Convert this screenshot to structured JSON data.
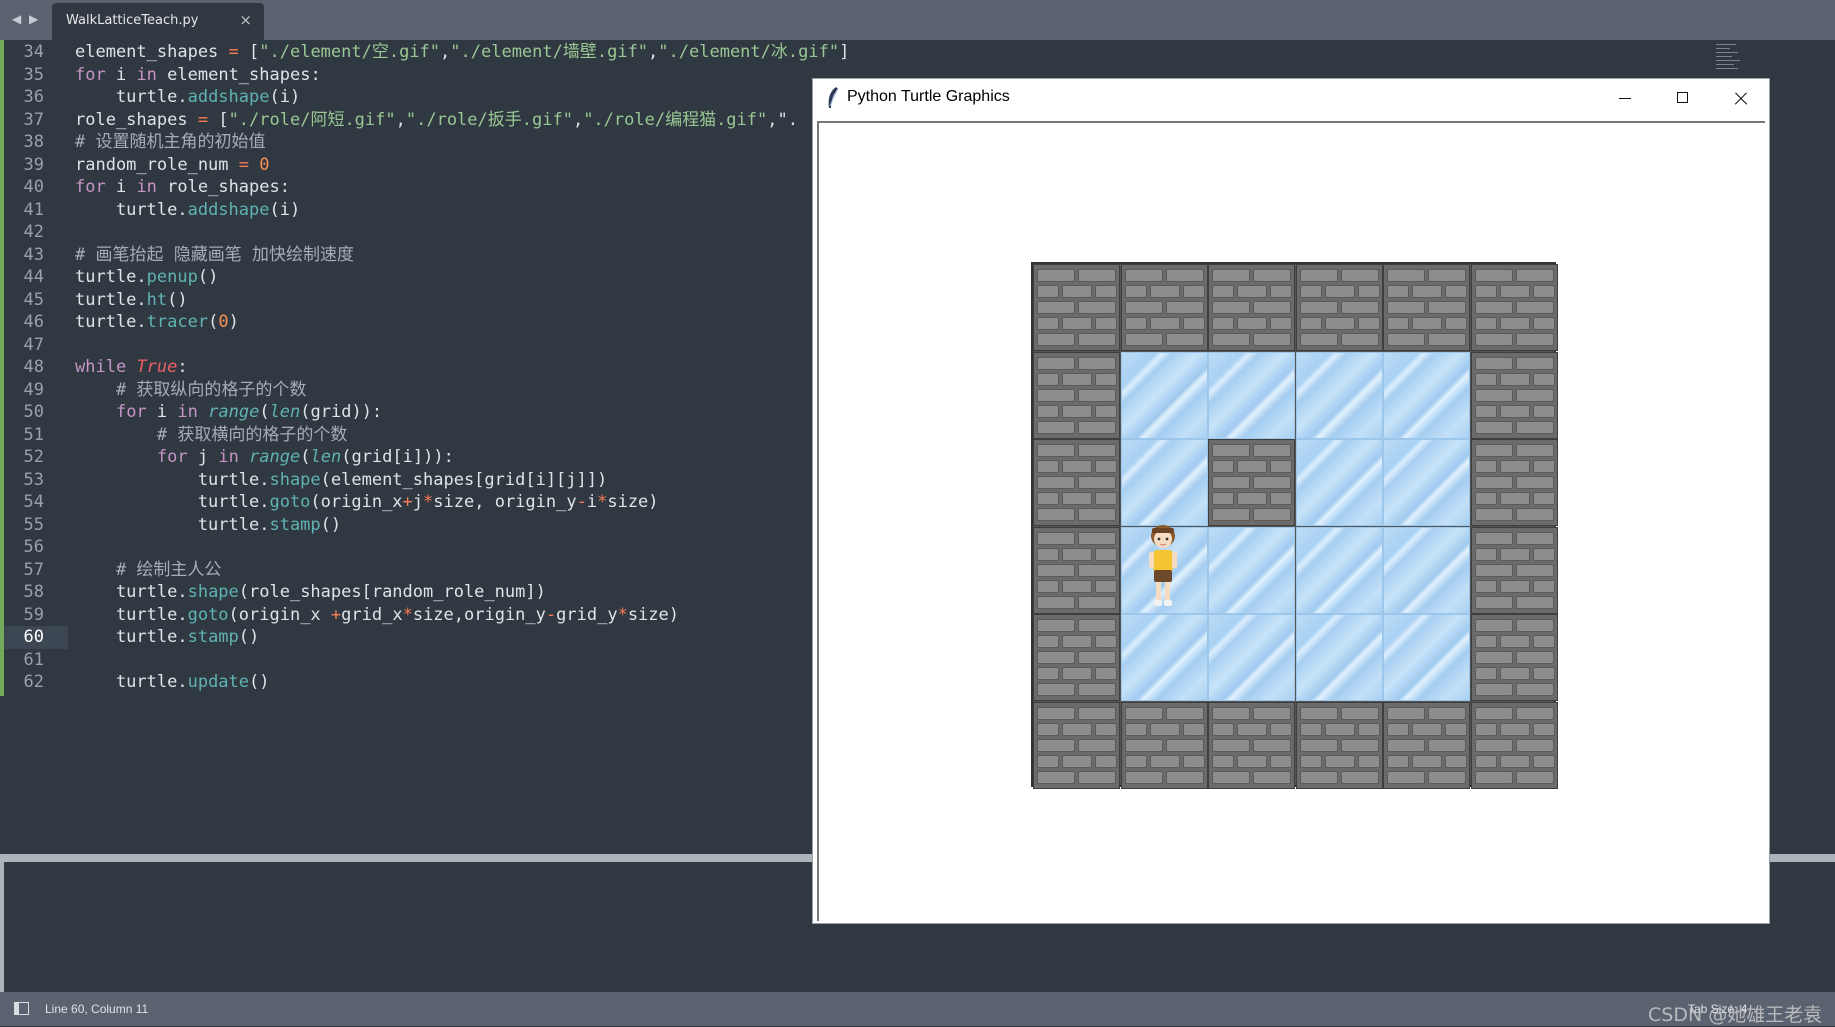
{
  "tabs": [
    {
      "label": "WalkLatticeTeach.py",
      "close": "×"
    }
  ],
  "nav": {
    "back": "◀",
    "forward": "▶"
  },
  "editor": {
    "current_line": "60",
    "lines": [
      {
        "n": "34",
        "segs": [
          [
            "",
            "element_shapes "
          ],
          [
            "o",
            "="
          ],
          [
            "",
            " ["
          ],
          [
            "s",
            "\"./element/空.gif\""
          ],
          [
            "",
            ","
          ],
          [
            "s",
            "\"./element/墙壁.gif\""
          ],
          [
            "",
            ","
          ],
          [
            "s",
            "\"./element/冰.gif\""
          ],
          [
            "",
            "]"
          ]
        ]
      },
      {
        "n": "35",
        "segs": [
          [
            "k",
            "for"
          ],
          [
            "",
            " i "
          ],
          [
            "k",
            "in"
          ],
          [
            "",
            " element_shapes:"
          ]
        ]
      },
      {
        "n": "36",
        "segs": [
          [
            "",
            "    turtle."
          ],
          [
            "f",
            "addshape"
          ],
          [
            "",
            "(i)"
          ]
        ]
      },
      {
        "n": "37",
        "segs": [
          [
            "",
            "role_shapes "
          ],
          [
            "o",
            "="
          ],
          [
            "",
            " ["
          ],
          [
            "s",
            "\"./role/阿短.gif\""
          ],
          [
            "",
            ","
          ],
          [
            "s",
            "\"./role/扳手.gif\""
          ],
          [
            "",
            ","
          ],
          [
            "s",
            "\"./role/编程猫.gif\""
          ],
          [
            "",
            ",\"."
          ]
        ]
      },
      {
        "n": "38",
        "segs": [
          [
            "c",
            "# 设置随机主角的初始值"
          ]
        ]
      },
      {
        "n": "39",
        "segs": [
          [
            "",
            "random_role_num "
          ],
          [
            "o",
            "="
          ],
          [
            "",
            " "
          ],
          [
            "n",
            "0"
          ]
        ]
      },
      {
        "n": "40",
        "segs": [
          [
            "k",
            "for"
          ],
          [
            "",
            " i "
          ],
          [
            "k",
            "in"
          ],
          [
            "",
            " role_shapes:"
          ]
        ]
      },
      {
        "n": "41",
        "segs": [
          [
            "",
            "    turtle."
          ],
          [
            "f",
            "addshape"
          ],
          [
            "",
            "(i)"
          ]
        ]
      },
      {
        "n": "42",
        "segs": []
      },
      {
        "n": "43",
        "segs": [
          [
            "c",
            "# 画笔抬起 隐藏画笔 加快绘制速度"
          ]
        ]
      },
      {
        "n": "44",
        "segs": [
          [
            "",
            "turtle."
          ],
          [
            "f",
            "penup"
          ],
          [
            "",
            "()"
          ]
        ]
      },
      {
        "n": "45",
        "segs": [
          [
            "",
            "turtle."
          ],
          [
            "f",
            "ht"
          ],
          [
            "",
            "()"
          ]
        ]
      },
      {
        "n": "46",
        "segs": [
          [
            "",
            "turtle."
          ],
          [
            "f",
            "tracer"
          ],
          [
            "",
            "("
          ],
          [
            "n",
            "0"
          ],
          [
            "",
            ")"
          ]
        ]
      },
      {
        "n": "47",
        "segs": []
      },
      {
        "n": "48",
        "segs": [
          [
            "k",
            "while"
          ],
          [
            "",
            " "
          ],
          [
            "b",
            "True"
          ],
          [
            "",
            ":"
          ]
        ]
      },
      {
        "n": "49",
        "segs": [
          [
            "",
            "    "
          ],
          [
            "c",
            "# 获取纵向的格子的个数"
          ]
        ]
      },
      {
        "n": "50",
        "segs": [
          [
            "",
            "    "
          ],
          [
            "k",
            "for"
          ],
          [
            "",
            " i "
          ],
          [
            "k",
            "in"
          ],
          [
            "",
            " "
          ],
          [
            "fi",
            "range"
          ],
          [
            "",
            "("
          ],
          [
            "fi",
            "len"
          ],
          [
            "",
            "(grid)):"
          ]
        ]
      },
      {
        "n": "51",
        "segs": [
          [
            "",
            "        "
          ],
          [
            "c",
            "# 获取横向的格子的个数"
          ]
        ]
      },
      {
        "n": "52",
        "segs": [
          [
            "",
            "        "
          ],
          [
            "k",
            "for"
          ],
          [
            "",
            " j "
          ],
          [
            "k",
            "in"
          ],
          [
            "",
            " "
          ],
          [
            "fi",
            "range"
          ],
          [
            "",
            "("
          ],
          [
            "fi",
            "len"
          ],
          [
            "",
            "(grid[i])):"
          ]
        ]
      },
      {
        "n": "53",
        "segs": [
          [
            "",
            "            turtle."
          ],
          [
            "f",
            "shape"
          ],
          [
            "",
            "(element_shapes[grid[i][j]])"
          ]
        ]
      },
      {
        "n": "54",
        "segs": [
          [
            "",
            "            turtle."
          ],
          [
            "f",
            "goto"
          ],
          [
            "",
            "(origin_x"
          ],
          [
            "o",
            "+"
          ],
          [
            "",
            "j"
          ],
          [
            "o",
            "*"
          ],
          [
            "",
            "size, origin_y"
          ],
          [
            "o",
            "-"
          ],
          [
            "",
            "i"
          ],
          [
            "o",
            "*"
          ],
          [
            "",
            "size)"
          ]
        ]
      },
      {
        "n": "55",
        "segs": [
          [
            "",
            "            turtle."
          ],
          [
            "f",
            "stamp"
          ],
          [
            "",
            "()"
          ]
        ]
      },
      {
        "n": "56",
        "segs": []
      },
      {
        "n": "57",
        "segs": [
          [
            "",
            "    "
          ],
          [
            "c",
            "# 绘制主人公"
          ]
        ]
      },
      {
        "n": "58",
        "segs": [
          [
            "",
            "    turtle."
          ],
          [
            "f",
            "shape"
          ],
          [
            "",
            "(role_shapes[random_role_num])"
          ]
        ]
      },
      {
        "n": "59",
        "segs": [
          [
            "",
            "    turtle."
          ],
          [
            "f",
            "goto"
          ],
          [
            "",
            "(origin_x "
          ],
          [
            "o",
            "+"
          ],
          [
            "",
            "grid_x"
          ],
          [
            "o",
            "*"
          ],
          [
            "",
            "size,origin_y"
          ],
          [
            "o",
            "-"
          ],
          [
            "",
            "grid_y"
          ],
          [
            "o",
            "*"
          ],
          [
            "",
            "size)"
          ]
        ]
      },
      {
        "n": "60",
        "segs": [
          [
            "",
            "    turtle."
          ],
          [
            "f",
            "stamp"
          ],
          [
            "",
            "()"
          ]
        ]
      },
      {
        "n": "61",
        "segs": []
      },
      {
        "n": "62",
        "segs": [
          [
            "",
            "    turtle."
          ],
          [
            "f",
            "update"
          ],
          [
            "",
            "()"
          ]
        ]
      }
    ]
  },
  "turtle_window": {
    "title": "Python Turtle Graphics",
    "icon": "feather-icon",
    "controls": [
      "minimize-icon",
      "maximize-icon",
      "close-icon"
    ],
    "grid": [
      [
        1,
        1,
        1,
        1,
        1,
        1
      ],
      [
        1,
        2,
        2,
        2,
        2,
        1
      ],
      [
        1,
        2,
        1,
        2,
        2,
        1
      ],
      [
        1,
        2,
        2,
        2,
        2,
        1
      ],
      [
        1,
        2,
        2,
        2,
        2,
        1
      ],
      [
        1,
        1,
        1,
        1,
        1,
        1
      ]
    ],
    "hero": {
      "col": 1,
      "row": 3
    }
  },
  "statusbar": {
    "position": "Line 60, Column 11",
    "right": "Tab Size: 4"
  },
  "watermark": "CSDN @她雄王老袁",
  "colors": {
    "accent_gutter": "#74a95a",
    "editor_bg": "#303841",
    "chrome": "#5b6370"
  }
}
